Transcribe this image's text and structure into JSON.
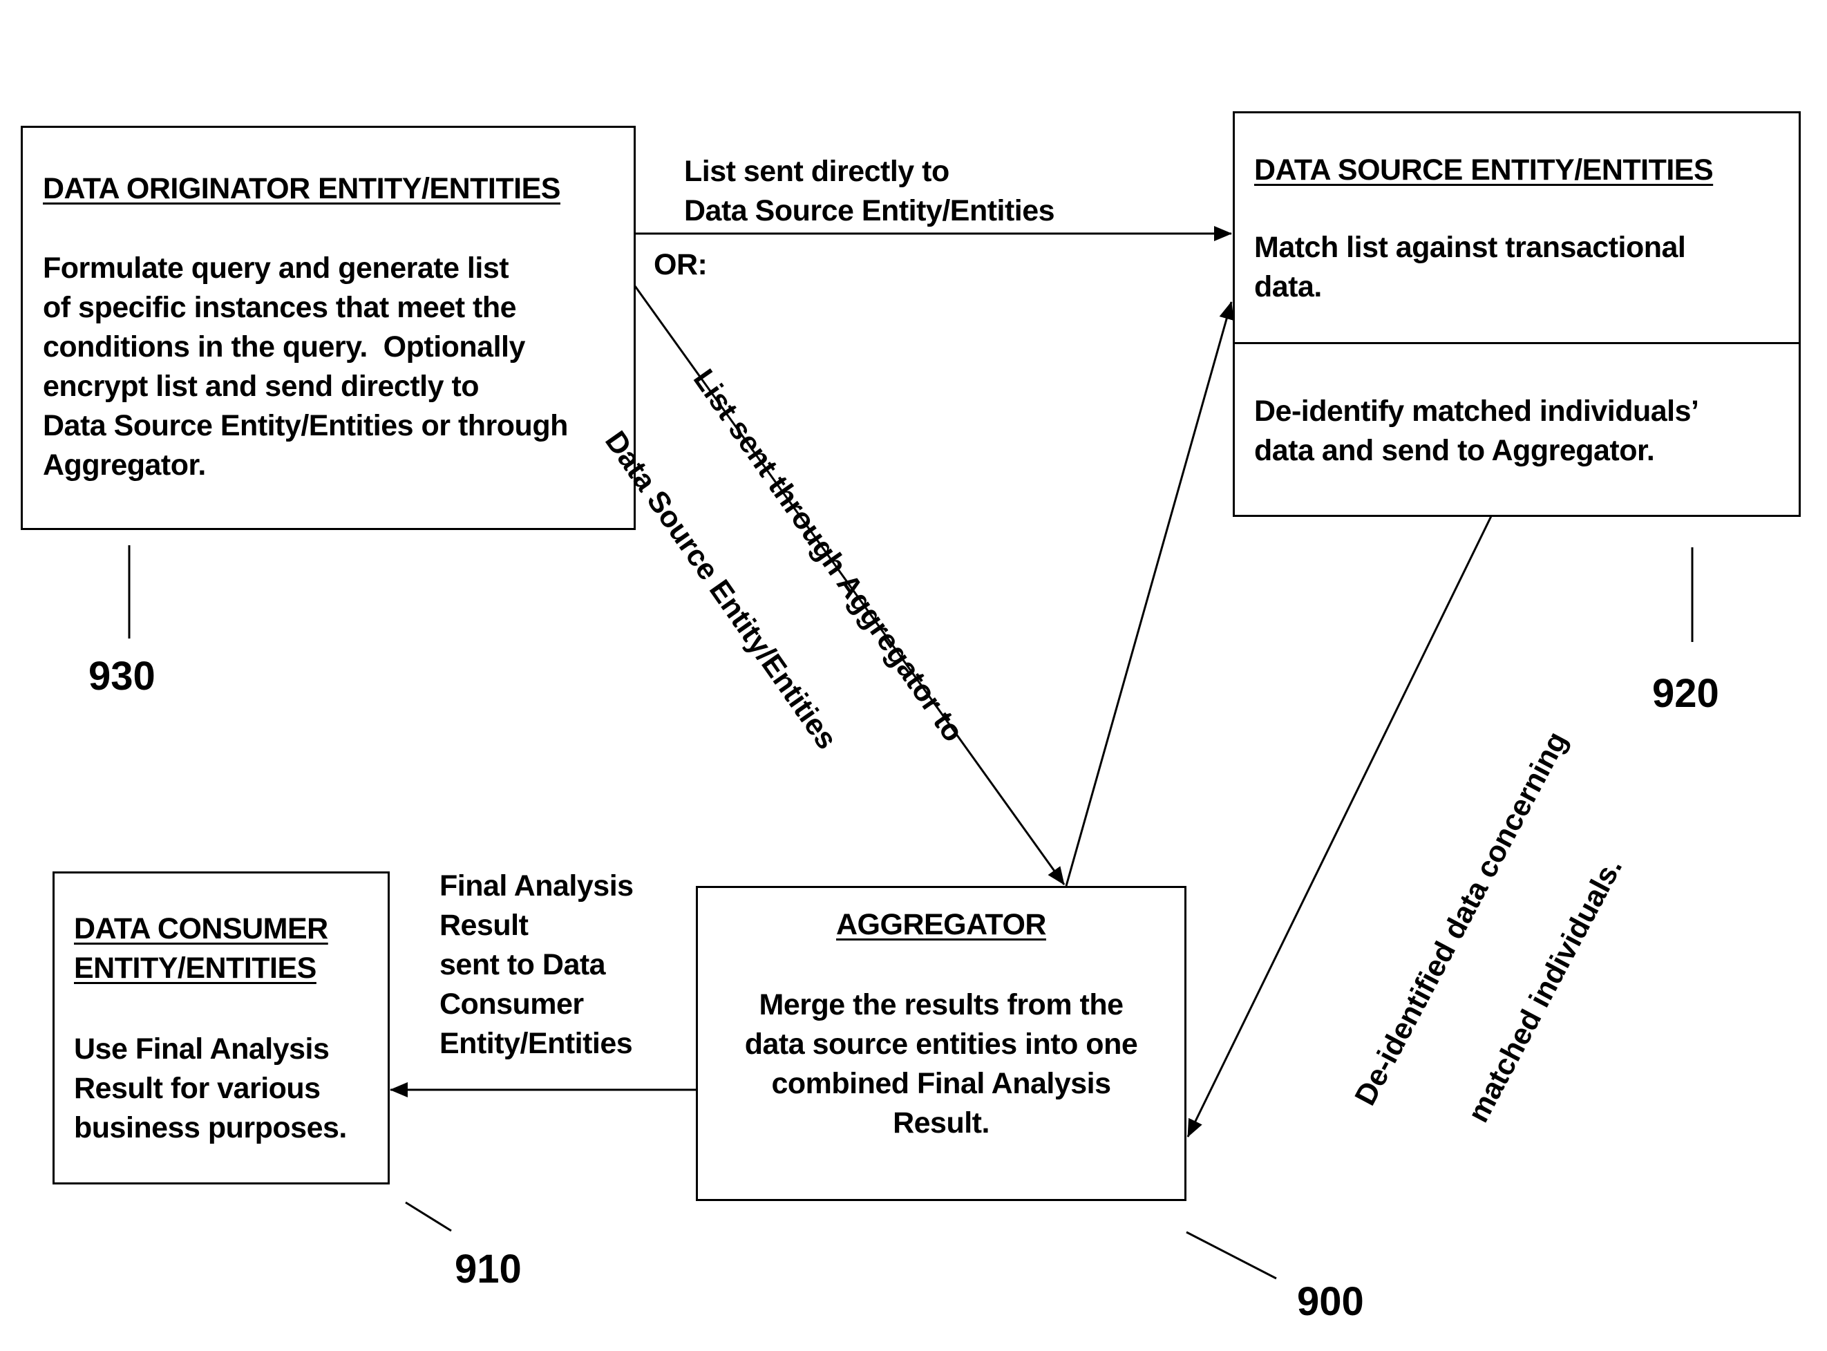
{
  "diagram": {
    "originator": {
      "title": "DATA ORIGINATOR ENTITY/ENTITIES",
      "body": [
        "Formulate query and generate list",
        "of specific instances that meet the",
        "conditions in the query.  Optionally",
        "encrypt list and send directly to",
        "Data Source Entity/Entities or through",
        "Aggregator."
      ],
      "ref": "930"
    },
    "source": {
      "title": "DATA SOURCE ENTITY/ENTITIES",
      "body_top": [
        "Match list against transactional",
        "data."
      ],
      "body_bottom": [
        "De-identify matched individuals’",
        "data and send to Aggregator."
      ],
      "ref": "920"
    },
    "consumer": {
      "title": [
        "DATA CONSUMER",
        "ENTITY/ENTITIES"
      ],
      "body": [
        "Use Final Analysis",
        "Result for various",
        "business purposes."
      ],
      "ref": "910"
    },
    "aggregator": {
      "title": "AGGREGATOR",
      "body": [
        "Merge the results from the",
        "data source entities into one",
        "combined Final Analysis",
        "Result."
      ],
      "ref": "900"
    },
    "edges": {
      "direct": [
        "List sent directly to",
        "Data Source Entity/Entities"
      ],
      "or": "OR:",
      "through": [
        "List sent through Aggregator to",
        "Data Source Entity/Entities"
      ],
      "deidentified": [
        "De-identified data concerning",
        "matched individuals."
      ],
      "final": [
        "Final Analysis",
        "Result",
        "sent to Data",
        "Consumer",
        "Entity/Entities"
      ]
    }
  }
}
